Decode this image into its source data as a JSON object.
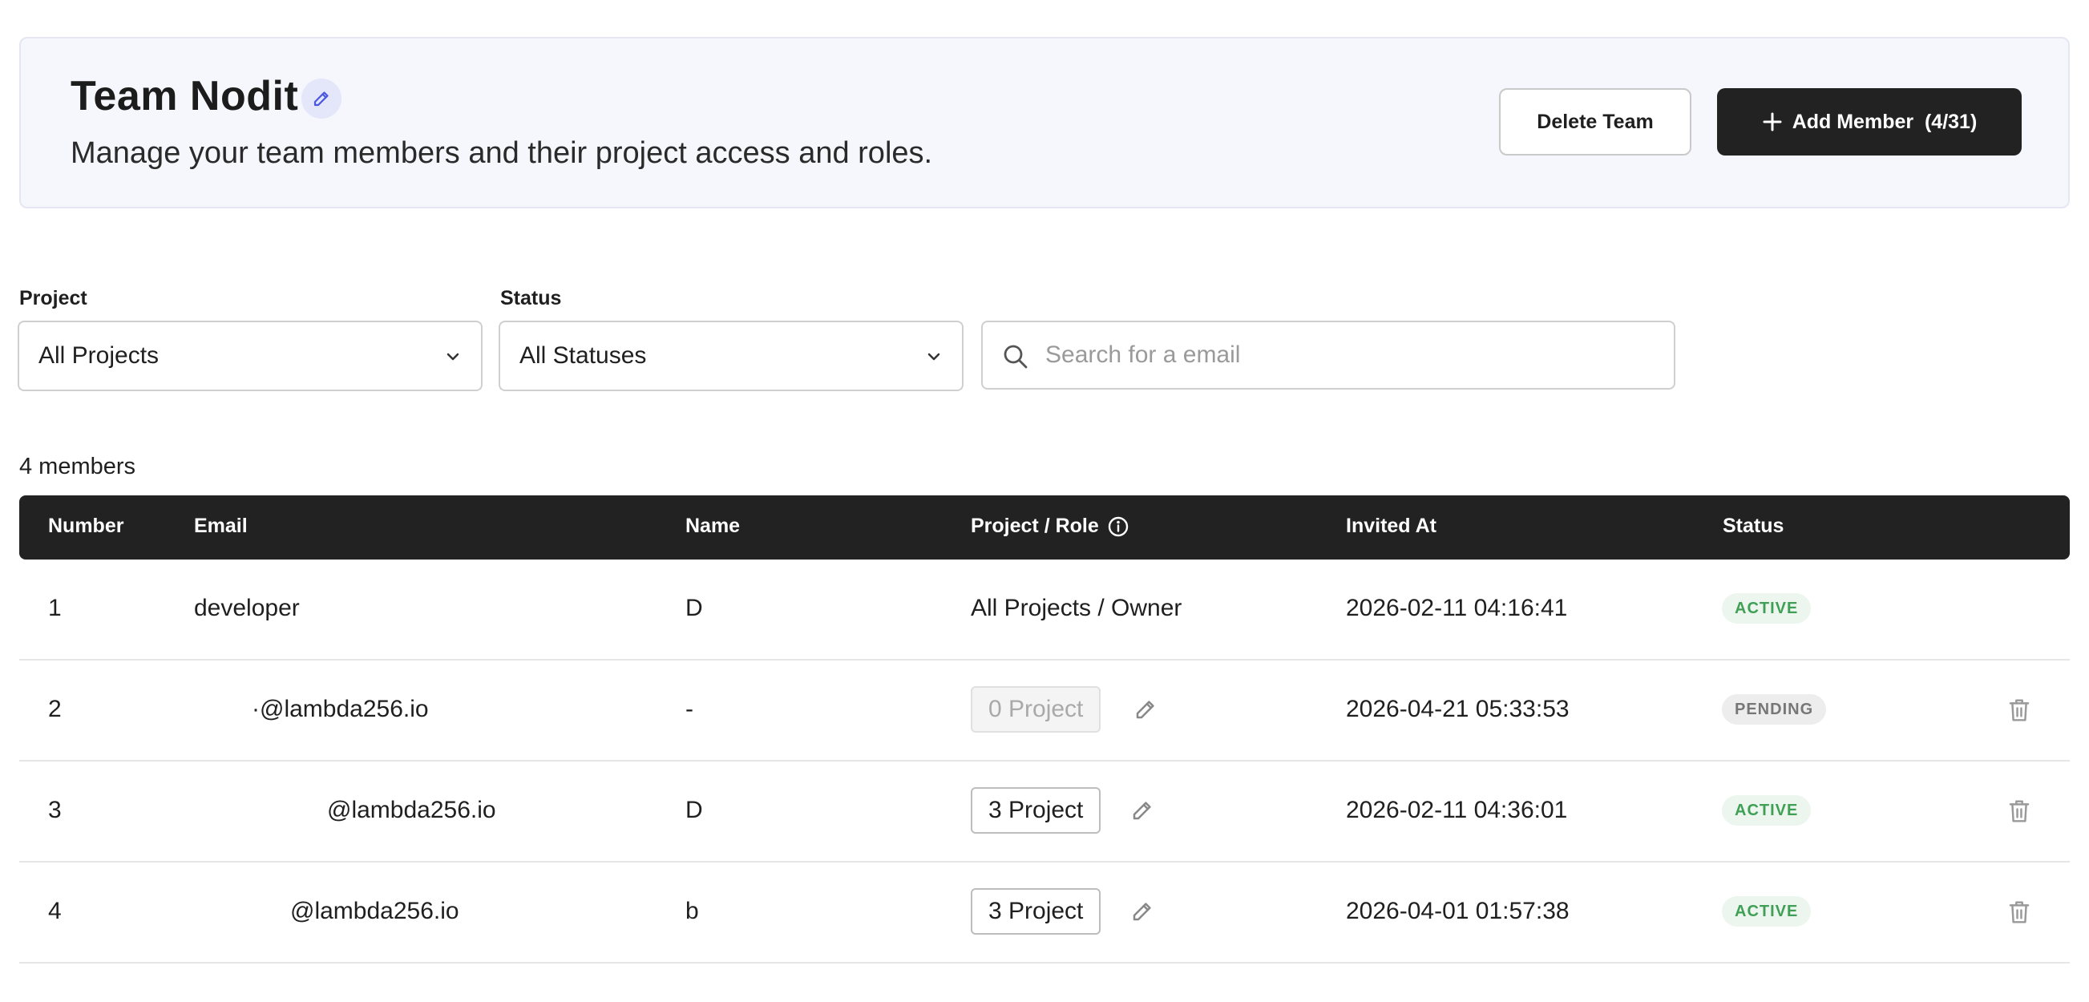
{
  "header": {
    "title": "Team Nodit",
    "subtitle": "Manage your team members and their project access and roles.",
    "delete_label": "Delete Team",
    "add_label": "Add Member  (4/31)"
  },
  "filters": {
    "project_label": "Project",
    "project_value": "All Projects",
    "status_label": "Status",
    "status_value": "All Statuses",
    "search_placeholder": "Search for a email"
  },
  "table": {
    "count_text": "4 members",
    "columns": [
      "Number",
      "Email",
      "Name",
      "Project / Role",
      "Invited At",
      "Status"
    ],
    "rows": [
      {
        "number": "1",
        "email": "developer",
        "name": "D",
        "project_role": "All Projects / Owner",
        "invited_at": "2026-02-11 04:16:41",
        "status": "ACTIVE"
      },
      {
        "number": "2",
        "email": "·@lambda256.io",
        "name": "-",
        "project_role": "0 Project",
        "invited_at": "2026-04-21 05:33:53",
        "status": "PENDING"
      },
      {
        "number": "3",
        "email": "@lambda256.io",
        "name": "D",
        "project_role": "3 Project",
        "invited_at": "2026-02-11 04:36:01",
        "status": "ACTIVE"
      },
      {
        "number": "4",
        "email": "@lambda256.io",
        "name": "b",
        "project_role": "3 Project",
        "invited_at": "2026-04-01 01:57:38",
        "status": "ACTIVE"
      }
    ]
  },
  "colors": {
    "accent": "#4a56e2",
    "dark": "#222222",
    "active_text": "#3f9f55",
    "pending_text": "#777777"
  },
  "icons": [
    "pencil-icon",
    "plus-icon",
    "chevron-down-icon",
    "search-icon",
    "info-icon",
    "trash-icon"
  ]
}
